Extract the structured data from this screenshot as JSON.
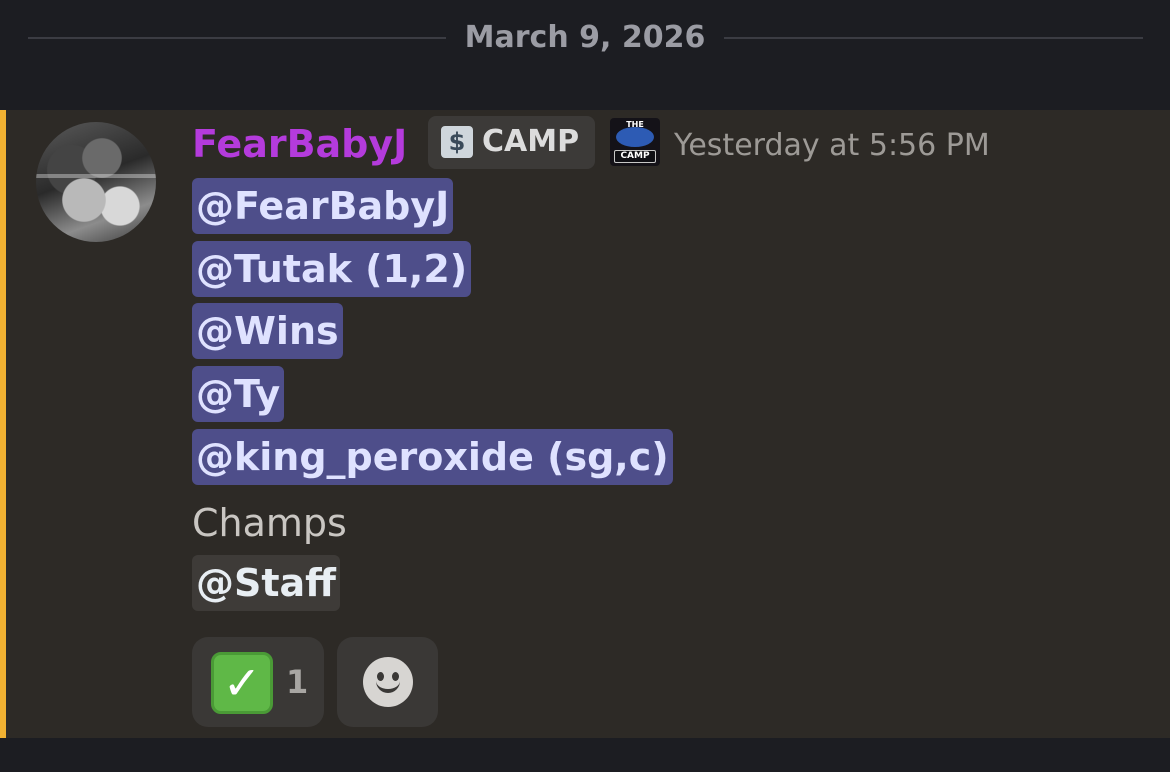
{
  "date_divider": {
    "label": "March 9, 2026"
  },
  "message": {
    "author": "FearBabyJ",
    "author_color": "#b43bdc",
    "guild_tag": {
      "icon": "server-tag-icon",
      "icon_glyph": "$",
      "label": "CAMP"
    },
    "badge": {
      "icon": "camp-badge-icon",
      "top_text": "THE",
      "bottom_text": "CAMP"
    },
    "timestamp": "Yesterday at 5:56 PM",
    "mentions": [
      "@FearBabyJ",
      "@Tutak (1,2)",
      "@Wins",
      "@Ty",
      "@king_peroxide (sg,c)"
    ],
    "body_text": "Champs",
    "role_mention": "@Staff",
    "highlight_color": "#f0b132",
    "mention_color": "#4e4e8a"
  },
  "reactions": [
    {
      "emoji": "✓",
      "icon": "check-mark-button-icon",
      "count": "1"
    }
  ],
  "add_reaction": {
    "icon": "add-reaction-smiley-icon"
  }
}
